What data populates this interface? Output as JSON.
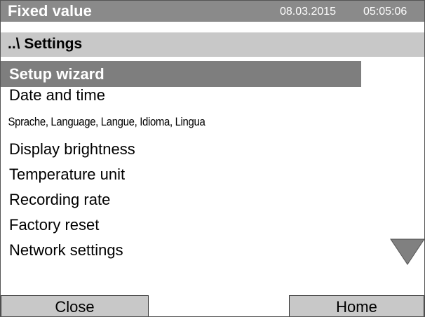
{
  "header": {
    "mode": "Fixed value",
    "date": "08.03.2015",
    "time": "05:05:06"
  },
  "breadcrumb": "..\\ Settings",
  "menu": {
    "items": [
      {
        "label": "Setup wizard",
        "selected": true
      },
      {
        "label": "Date and time",
        "selected": false
      },
      {
        "label": "Sprache, Language, Langue, Idioma, Lingua",
        "selected": false
      },
      {
        "label": "Display brightness",
        "selected": false
      },
      {
        "label": "Temperature unit",
        "selected": false
      },
      {
        "label": "Recording rate",
        "selected": false
      },
      {
        "label": "Factory reset",
        "selected": false
      },
      {
        "label": "Network settings",
        "selected": false
      }
    ]
  },
  "scroll": {
    "icon": "triangle-down-icon"
  },
  "footer": {
    "close_label": "Close",
    "home_label": "Home"
  },
  "colors": {
    "header_bg": "#8a8a8a",
    "selected_bg": "#7e7e7e",
    "breadcrumb_bg": "#c8c8c8",
    "button_bg": "#c8c8c8",
    "arrow": "#808080"
  }
}
